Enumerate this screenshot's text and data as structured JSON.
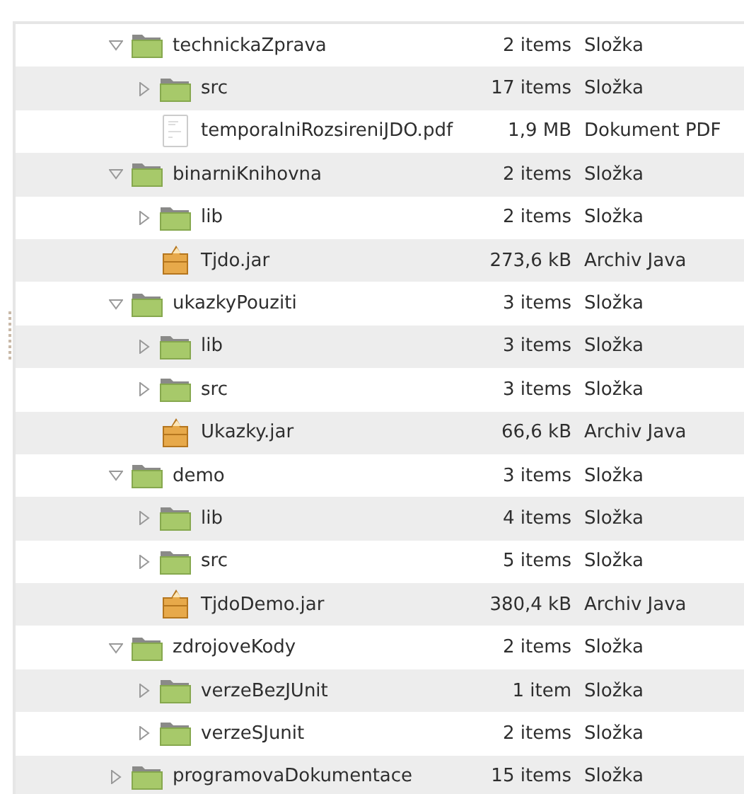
{
  "file_tree": {
    "items": [
      {
        "kind": "folder",
        "name": "technickaZprava",
        "size": "2 items",
        "type": "Složka",
        "expanded": true,
        "children": [
          {
            "kind": "folder",
            "name": "src",
            "size": "17 items",
            "type": "Složka",
            "expanded": false
          },
          {
            "kind": "pdf",
            "name": "temporalniRozsireniJDO.pdf",
            "size": "1,9 MB",
            "type": "Dokument PDF"
          }
        ]
      },
      {
        "kind": "folder",
        "name": "binarniKnihovna",
        "size": "2 items",
        "type": "Složka",
        "expanded": true,
        "children": [
          {
            "kind": "folder",
            "name": "lib",
            "size": "2 items",
            "type": "Složka",
            "expanded": false
          },
          {
            "kind": "jar",
            "name": "Tjdo.jar",
            "size": "273,6 kB",
            "type": "Archiv Java"
          }
        ]
      },
      {
        "kind": "folder",
        "name": "ukazkyPouziti",
        "size": "3 items",
        "type": "Složka",
        "expanded": true,
        "children": [
          {
            "kind": "folder",
            "name": "lib",
            "size": "3 items",
            "type": "Složka",
            "expanded": false
          },
          {
            "kind": "folder",
            "name": "src",
            "size": "3 items",
            "type": "Složka",
            "expanded": false
          },
          {
            "kind": "jar",
            "name": "Ukazky.jar",
            "size": "66,6 kB",
            "type": "Archiv Java"
          }
        ]
      },
      {
        "kind": "folder",
        "name": "demo",
        "size": "3 items",
        "type": "Složka",
        "expanded": true,
        "children": [
          {
            "kind": "folder",
            "name": "lib",
            "size": "4 items",
            "type": "Složka",
            "expanded": false
          },
          {
            "kind": "folder",
            "name": "src",
            "size": "5 items",
            "type": "Složka",
            "expanded": false
          },
          {
            "kind": "jar",
            "name": "TjdoDemo.jar",
            "size": "380,4 kB",
            "type": "Archiv Java"
          }
        ]
      },
      {
        "kind": "folder",
        "name": "zdrojoveKody",
        "size": "2 items",
        "type": "Složka",
        "expanded": true,
        "children": [
          {
            "kind": "folder",
            "name": "verzeBezJUnit",
            "size": "1 item",
            "type": "Složka",
            "expanded": false
          },
          {
            "kind": "folder",
            "name": "verzeSJunit",
            "size": "2 items",
            "type": "Složka",
            "expanded": false
          }
        ]
      },
      {
        "kind": "folder",
        "name": "programovaDokumentace",
        "size": "15 items",
        "type": "Složka",
        "expanded": false
      }
    ]
  }
}
